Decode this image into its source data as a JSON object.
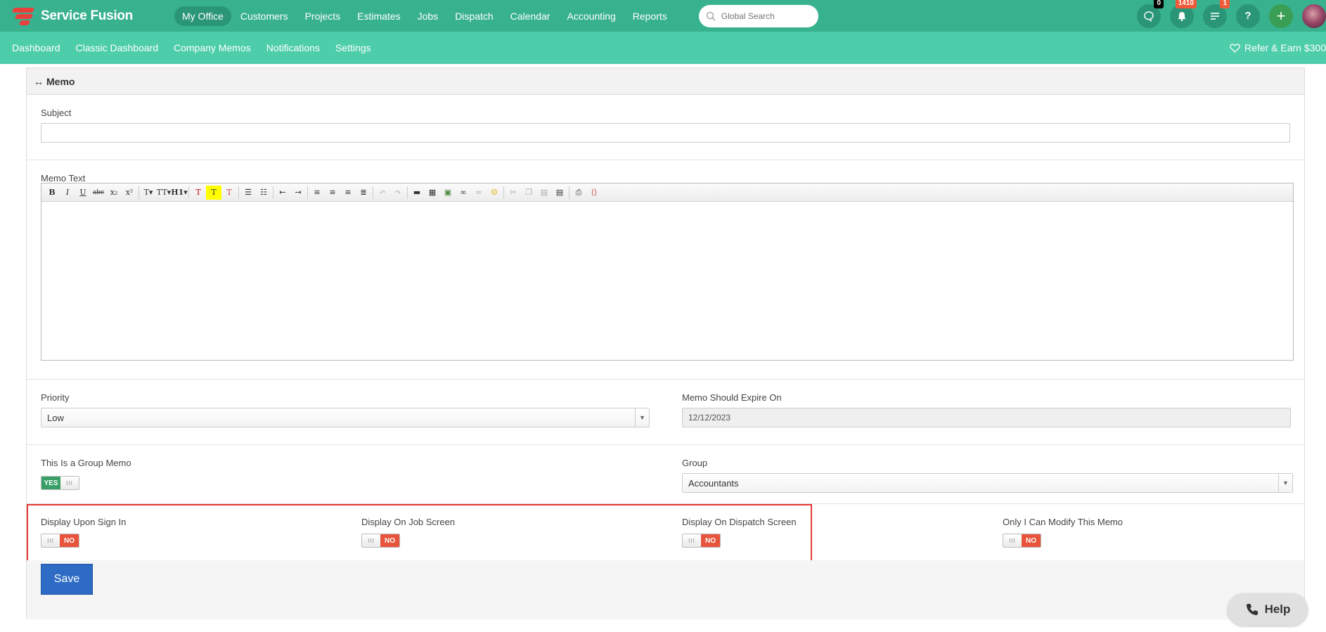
{
  "app": {
    "name": "Service Fusion"
  },
  "main_nav": [
    {
      "label": "My Office",
      "active": true
    },
    {
      "label": "Customers"
    },
    {
      "label": "Projects"
    },
    {
      "label": "Estimates"
    },
    {
      "label": "Jobs"
    },
    {
      "label": "Dispatch"
    },
    {
      "label": "Calendar"
    },
    {
      "label": "Accounting"
    },
    {
      "label": "Reports"
    }
  ],
  "search": {
    "placeholder": "Global Search"
  },
  "header_icons": {
    "chat_badge": "0",
    "notifications_badge": "1410",
    "tasks_badge": "1",
    "help_label": "?",
    "add_label": "+"
  },
  "sub_nav": [
    "Dashboard",
    "Classic Dashboard",
    "Company Memos",
    "Notifications",
    "Settings"
  ],
  "refer": {
    "label": "Refer & Earn $300"
  },
  "panel": {
    "title": "Memo",
    "title_icon": "↔"
  },
  "form": {
    "subject_label": "Subject",
    "subject_value": "",
    "memo_text_label": "Memo Text",
    "priority_label": "Priority",
    "priority_value": "Low",
    "expire_label": "Memo Should Expire On",
    "expire_value": "12/12/2023",
    "group_memo_label": "This Is a Group Memo",
    "group_memo_value": "YES",
    "group_label": "Group",
    "group_value": "Accountants",
    "sign_in_label": "Display Upon Sign In",
    "sign_in_value": "NO",
    "job_screen_label": "Display On Job Screen",
    "job_screen_value": "NO",
    "dispatch_screen_label": "Display On Dispatch Screen",
    "dispatch_screen_value": "NO",
    "modify_label": "Only I Can Modify This Memo",
    "modify_value": "NO",
    "toggle_handle": "III",
    "save_label": "Save"
  },
  "help": {
    "label": "Help"
  },
  "colors": {
    "topbar": "#38b18e",
    "subbar": "#4dcdaa",
    "no": "#e8533b",
    "yes": "#38a067",
    "save": "#2e6bc4",
    "highlight": "#e53935"
  }
}
